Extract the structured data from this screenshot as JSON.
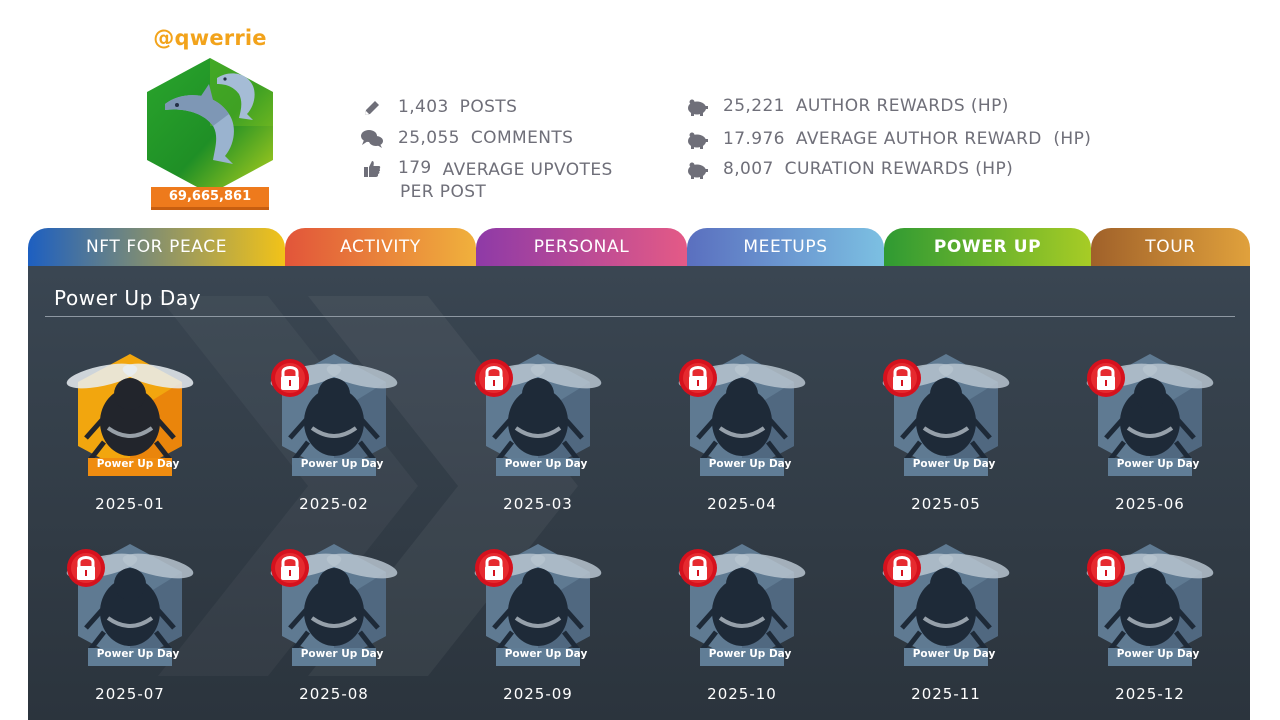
{
  "profile": {
    "username": "@qwerrie",
    "score": "69,665,861"
  },
  "stats_left": [
    {
      "icon": "pencil-icon",
      "value": "1,403",
      "label": "POSTS",
      "label2": ""
    },
    {
      "icon": "comments-icon",
      "value": "25,055",
      "label": "COMMENTS",
      "label2": ""
    },
    {
      "icon": "thumbs-up-icon",
      "value": "179",
      "label": "AVERAGE UPVOTES",
      "label2": "PER POST"
    }
  ],
  "stats_right": [
    {
      "icon": "piggy-bank-icon",
      "value": "25,221",
      "label": "AUTHOR REWARDS (HP)"
    },
    {
      "icon": "piggy-bank-icon",
      "value": "17.976",
      "label": "AVERAGE AUTHOR REWARD  (HP)"
    },
    {
      "icon": "piggy-bank-icon",
      "value": "8,007",
      "label": "CURATION REWARDS (HP)"
    }
  ],
  "tabs": [
    {
      "label": "NFT FOR PEACE",
      "active": false,
      "color_from": "#1d5fc1",
      "color_to": "#f2c318"
    },
    {
      "label": "ACTIVITY",
      "active": false,
      "color_from": "#e2553a",
      "color_to": "#f0b13c"
    },
    {
      "label": "PERSONAL",
      "active": false,
      "color_from": "#8e3aa7",
      "color_to": "#e45a86"
    },
    {
      "label": "MEETUPS",
      "active": false,
      "color_from": "#5a6fbf",
      "color_to": "#7cc0e2"
    },
    {
      "label": "POWER UP",
      "active": true,
      "color_from": "#2f9a33",
      "color_to": "#a7cc25"
    },
    {
      "label": "TOUR",
      "active": false,
      "color_from": "#a0612a",
      "color_to": "#e0a13c"
    }
  ],
  "panel": {
    "title": "Power Up Day"
  },
  "badges": [
    {
      "date": "2025-01",
      "ribbon": "Power Up Day",
      "locked": false
    },
    {
      "date": "2025-02",
      "ribbon": "Power Up Day",
      "locked": true
    },
    {
      "date": "2025-03",
      "ribbon": "Power Up Day",
      "locked": true
    },
    {
      "date": "2025-04",
      "ribbon": "Power Up Day",
      "locked": true
    },
    {
      "date": "2025-05",
      "ribbon": "Power Up Day",
      "locked": true
    },
    {
      "date": "2025-06",
      "ribbon": "Power Up Day",
      "locked": true
    },
    {
      "date": "2025-07",
      "ribbon": "Power Up Day",
      "locked": true
    },
    {
      "date": "2025-08",
      "ribbon": "Power Up Day",
      "locked": true
    },
    {
      "date": "2025-09",
      "ribbon": "Power Up Day",
      "locked": true
    },
    {
      "date": "2025-10",
      "ribbon": "Power Up Day",
      "locked": true
    },
    {
      "date": "2025-11",
      "ribbon": "Power Up Day",
      "locked": true
    },
    {
      "date": "2025-12",
      "ribbon": "Power Up Day",
      "locked": true
    }
  ]
}
